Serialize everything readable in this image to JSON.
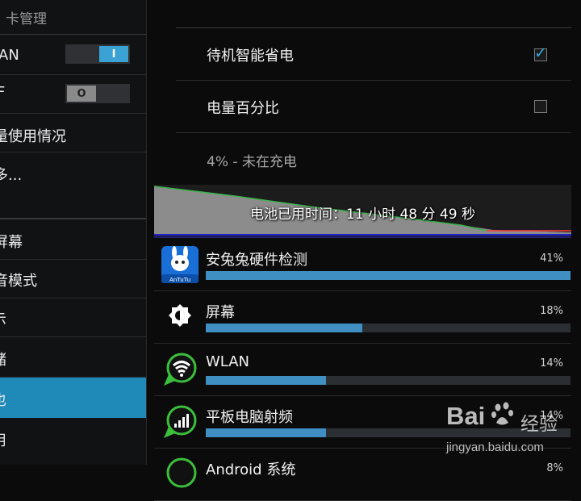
{
  "sidebar": {
    "title": "卡管理",
    "items": [
      {
        "label": "AN",
        "toggle": {
          "state": "on",
          "glyph": "I"
        }
      },
      {
        "label": "F",
        "toggle": {
          "state": "off",
          "glyph": "O"
        }
      },
      {
        "label": "量使用情况"
      },
      {
        "label": "多..."
      },
      {
        "label": ""
      },
      {
        "label": "屏幕"
      },
      {
        "label": "音模式"
      },
      {
        "label": "示"
      },
      {
        "label": "储"
      },
      {
        "label": "也",
        "active": true
      },
      {
        "label": "用"
      }
    ]
  },
  "settings": [
    {
      "label": "待机智能省电",
      "checked": true
    },
    {
      "label": "电量百分比",
      "checked": false
    }
  ],
  "status_text": "4% - 未在充电",
  "graph": {
    "label": "电池已用时间：11 小时 48 分 49 秒",
    "fill_color": "#8c8c8c",
    "line_color": "#3cb44a",
    "baseline_color": "#2222cc",
    "marker_color": "#ff3b3b"
  },
  "apps": [
    {
      "name": "安兔兔硬件检测",
      "percent": "41%",
      "bar_fraction": 1.0,
      "icon": "antutu-icon",
      "icon_text": "AnTuTu"
    },
    {
      "name": "屏幕",
      "percent": "18%",
      "bar_fraction": 0.43,
      "icon": "brightness-icon"
    },
    {
      "name": "WLAN",
      "percent": "14%",
      "bar_fraction": 0.33,
      "icon": "wifi-icon"
    },
    {
      "name": "平板电脑射频",
      "percent": "14%",
      "bar_fraction": 0.33,
      "icon": "signal-icon"
    },
    {
      "name": "Android 系统",
      "percent": "8%",
      "bar_fraction": 0.2,
      "icon": "android-icon"
    }
  ],
  "watermark": {
    "logo": "Bai",
    "logo_cn": "经验",
    "url": "jingyan.baidu.com"
  },
  "colors": {
    "accent": "#1f89b8",
    "bar": "#3f8fc2",
    "check": "#35a8e0"
  }
}
